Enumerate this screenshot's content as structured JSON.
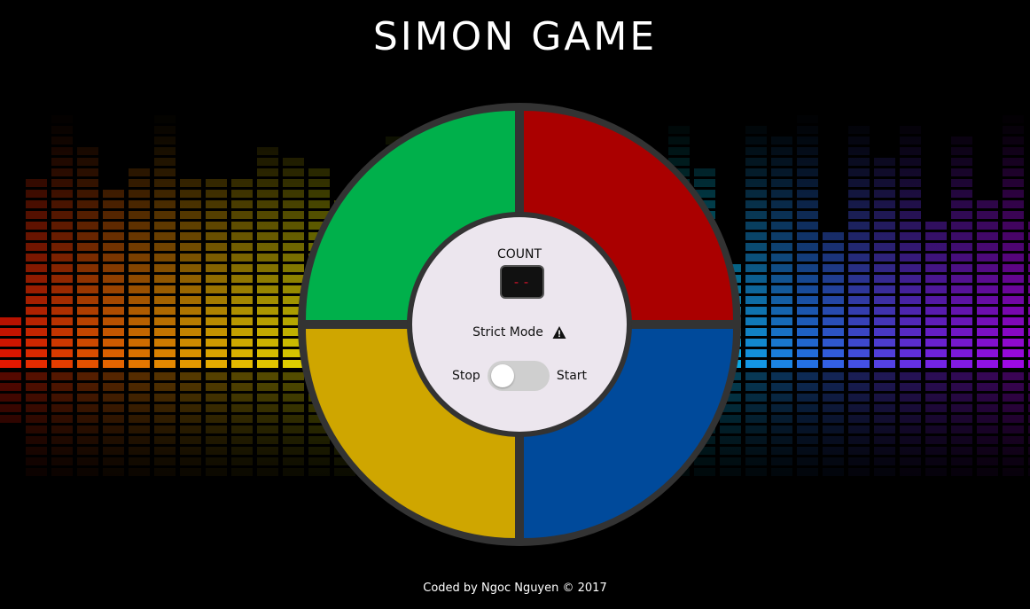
{
  "header": {
    "title": "SIMON GAME"
  },
  "board": {
    "pads": {
      "green": "#00b04b",
      "red": "#aa0000",
      "yellow": "#cfa600",
      "blue": "#004a9b"
    },
    "ring_color": "#333333",
    "center_color": "#ece6ee"
  },
  "controls": {
    "count_label": "COUNT",
    "count_value": "--",
    "strict_label": "Strict Mode",
    "strict_icon": "warning-icon",
    "stop_label": "Stop",
    "start_label": "Start",
    "power_on": false
  },
  "footer": {
    "text": "Coded by Ngoc Nguyen © 2017"
  },
  "background": {
    "equalizer_colors": [
      "#ff1a00",
      "#ff7a00",
      "#ffd000",
      "#f2ff00",
      "#9dff2e",
      "#00e676",
      "#00d8ff",
      "#2a7bff",
      "#7c2cff",
      "#c000ff"
    ]
  }
}
